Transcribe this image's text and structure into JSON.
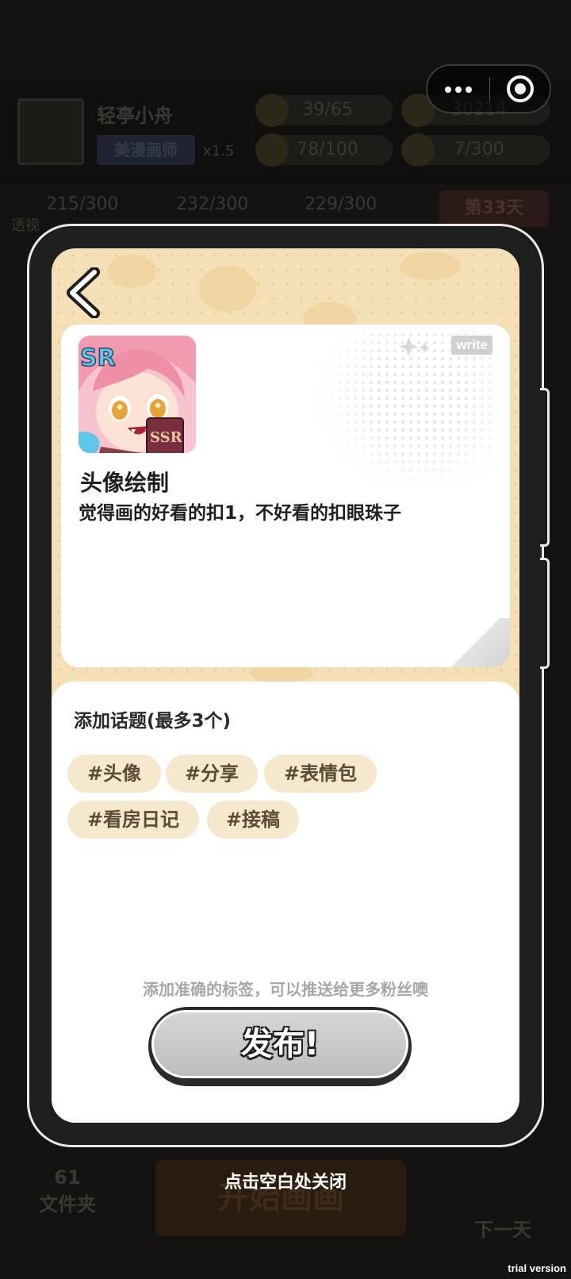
{
  "background": {
    "player_name": "轻亭小舟",
    "title_badge": "美漫画师",
    "multiplier": "x1.5",
    "stat_pills": [
      "39/65",
      "30214",
      "78/100",
      "7/300"
    ],
    "skill_stats": [
      "215/300",
      "232/300",
      "229/300"
    ],
    "skill_label": "透视",
    "day": "第33天",
    "folder_count": "61",
    "folder_label": "文件夹",
    "start_button": "开始画画",
    "next_day": "下一天"
  },
  "modal": {
    "post": {
      "badge": "write",
      "title": "头像绘制",
      "text": "觉得画的好看的扣1，不好看的扣眼珠子"
    },
    "topics": {
      "heading": "添加话题(最多3个)",
      "tags": [
        "#头像",
        "#分享",
        "#表情包",
        "#看房日记",
        "#接稿"
      ]
    },
    "hint": "添加准确的标签，可以推送给更多粉丝噢",
    "publish_label": "发布!"
  },
  "close_hint": "点击空白处关闭",
  "watermark": "trial version"
}
